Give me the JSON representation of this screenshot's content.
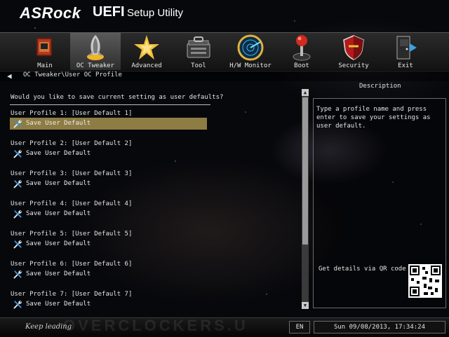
{
  "header": {
    "brand": "ASRock",
    "uefi": "UEFI",
    "subtitle": "Setup Utility"
  },
  "tabs": [
    {
      "label": "Main",
      "icon": "main-icon"
    },
    {
      "label": "OC Tweaker",
      "icon": "rocket-icon",
      "active": true
    },
    {
      "label": "Advanced",
      "icon": "star-burst-icon"
    },
    {
      "label": "Tool",
      "icon": "toolbox-icon"
    },
    {
      "label": "H/W Monitor",
      "icon": "radar-icon"
    },
    {
      "label": "Boot",
      "icon": "joystick-icon"
    },
    {
      "label": "Security",
      "icon": "shield-icon"
    },
    {
      "label": "Exit",
      "icon": "exit-door-icon"
    }
  ],
  "breadcrumb": "OC Tweaker\\User OC Profile",
  "question": "Would you like to save current setting as user defaults?",
  "profiles": [
    {
      "label": "User Profile 1: [User Default 1]",
      "action": "Save User Default"
    },
    {
      "label": "User Profile 2: [User Default 2]",
      "action": "Save User Default"
    },
    {
      "label": "User Profile 3: [User Default 3]",
      "action": "Save User Default"
    },
    {
      "label": "User Profile 4: [User Default 4]",
      "action": "Save User Default"
    },
    {
      "label": "User Profile 5: [User Default 5]",
      "action": "Save User Default"
    },
    {
      "label": "User Profile 6: [User Default 6]",
      "action": "Save User Default"
    },
    {
      "label": "User Profile 7: [User Default 7]",
      "action": "Save User Default"
    }
  ],
  "selected_profile_index": 0,
  "description": {
    "title": "Description",
    "text": "Type a profile name and press enter to save your settings as user default.",
    "qr_text": "Get details via QR code"
  },
  "footer": {
    "slogan": "Keep leading",
    "watermark": "OVERCLOCKERS.U",
    "language": "EN",
    "datetime": "Sun 09/08/2013, 17:34:24"
  },
  "colors": {
    "selection": "#8d7c43",
    "accent": "#d9d9d9"
  }
}
